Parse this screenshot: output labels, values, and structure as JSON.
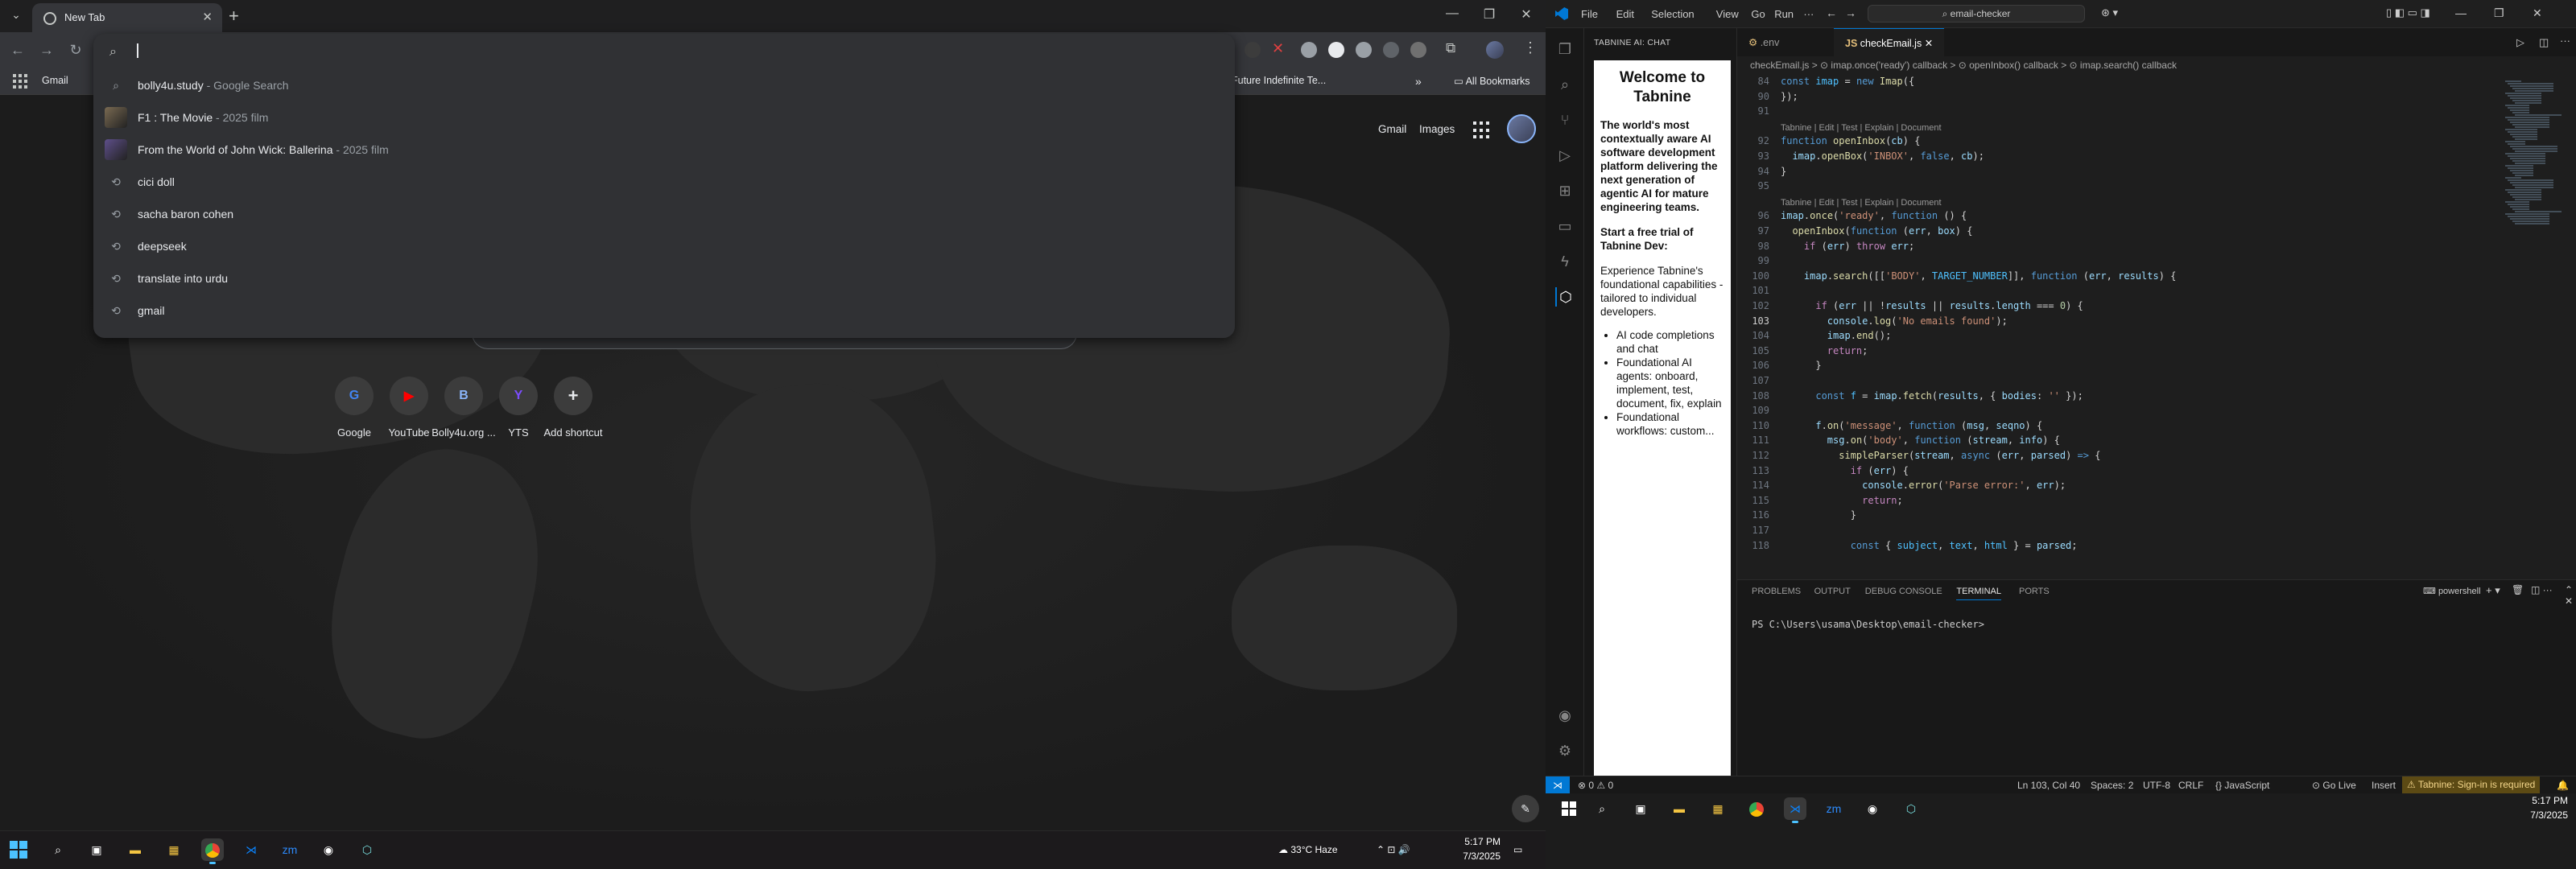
{
  "chrome": {
    "tab_title": "New Tab",
    "bookmarks": [
      {
        "label": "Gmail"
      },
      {
        "label": "Future Indefinite Te..."
      }
    ],
    "all_bookmarks_label": "All Bookmarks",
    "omnibox_value": "",
    "suggestions": [
      {
        "icon": "search-icon",
        "text": "bolly4u.study",
        "sub": "- Google Search"
      },
      {
        "icon": "thumbnail",
        "text": "F1 : The Movie",
        "sub": "- 2025 film",
        "thumb_color": "#7a6a52"
      },
      {
        "icon": "thumbnail",
        "text": "From the World of John Wick: Ballerina",
        "sub": "- 2025 film",
        "thumb_color": "#5e4f8a"
      },
      {
        "icon": "history-icon",
        "text": "cici doll",
        "sub": ""
      },
      {
        "icon": "history-icon",
        "text": "sacha baron cohen",
        "sub": ""
      },
      {
        "icon": "history-icon",
        "text": "deepseek",
        "sub": ""
      },
      {
        "icon": "history-icon",
        "text": "translate into urdu",
        "sub": ""
      },
      {
        "icon": "history-icon",
        "text": "gmail",
        "sub": ""
      }
    ],
    "ntp": {
      "gmail_label": "Gmail",
      "images_label": "Images",
      "shortcuts": [
        {
          "label": "Google",
          "glyph": "G",
          "color": "#4285f4"
        },
        {
          "label": "YouTube",
          "glyph": "▶",
          "color": "#ff0000"
        },
        {
          "label": "Bolly4u.org ...",
          "glyph": "B",
          "color": "#8ab4f8"
        },
        {
          "label": "YTS",
          "glyph": "Y",
          "color": "#7c4dff"
        },
        {
          "label": "Add shortcut",
          "glyph": "+",
          "color": "#e8eaed"
        }
      ]
    }
  },
  "vscode": {
    "menu": [
      "File",
      "Edit",
      "Selection",
      "View",
      "Go",
      "Run",
      "···"
    ],
    "command_center": "email-checker",
    "sidebar_title": "TABNINE AI: CHAT",
    "tabnine": {
      "welcome": "Welcome to Tabnine",
      "intro": "The world's most contextually aware AI software development platform delivering the next generation of agentic AI for mature engineering teams.",
      "trial": "Start a free trial of Tabnine Dev:",
      "desc": "Experience Tabnine's foundational capabilities - tailored to individual developers.",
      "features": [
        "AI code completions and chat",
        "Foundational AI agents: onboard, implement, test, document, fix, explain",
        "Foundational workflows: custom..."
      ]
    },
    "tabs": [
      {
        "label": ".env",
        "active": false
      },
      {
        "label": "checkEmail.js",
        "active": true
      }
    ],
    "breadcrumb": "checkEmail.js > ⊙ imap.once('ready') callback > ⊙ openInbox() callback > ⊙ imap.search() callback",
    "codelens": "Tabnine | Edit | Test | Explain | Document",
    "code": [
      {
        "n": "84",
        "html": "<span class='kb'>const</span> <span class='c'>imap</span> = <span class='kb'>new</span> <span class='f'>Imap</span>({"
      },
      {
        "n": "90",
        "html": "});"
      },
      {
        "n": "91",
        "html": ""
      },
      {
        "lens": true
      },
      {
        "n": "92",
        "html": "<span class='kb'>function</span> <span class='f'>openInbox</span>(<span class='v'>cb</span>) {"
      },
      {
        "n": "93",
        "html": "  <span class='v'>imap</span>.<span class='f'>openBox</span>(<span class='s'>'INBOX'</span>, <span class='kb'>false</span>, <span class='v'>cb</span>);"
      },
      {
        "n": "94",
        "html": "}"
      },
      {
        "n": "95",
        "html": ""
      },
      {
        "lens": true
      },
      {
        "n": "96",
        "html": "<span class='v'>imap</span>.<span class='f'>once</span>(<span class='s'>'ready'</span>, <span class='kb'>function</span> () {"
      },
      {
        "n": "97",
        "html": "  <span class='f'>openInbox</span>(<span class='kb'>function</span> (<span class='v'>err</span>, <span class='v'>box</span>) {"
      },
      {
        "n": "98",
        "html": "    <span class='k'>if</span> (<span class='v'>err</span>) <span class='k'>throw</span> <span class='v'>err</span>;"
      },
      {
        "n": "99",
        "html": ""
      },
      {
        "n": "100",
        "html": "    <span class='v'>imap</span>.<span class='f'>search</span>([[<span class='s'>'BODY'</span>, <span class='c'>TARGET_NUMBER</span>]], <span class='kb'>function</span> (<span class='v'>err</span>, <span class='v'>results</span>) {"
      },
      {
        "n": "101",
        "html": ""
      },
      {
        "n": "102",
        "html": "      <span class='k'>if</span> (<span class='v'>err</span> || !<span class='v'>results</span> || <span class='v'>results</span>.<span class='v'>length</span> === <span class='n'>0</span>) {"
      },
      {
        "n": "103",
        "html": "        <span class='v'>console</span>.<span class='f'>log</span>(<span class='s'>'No emails found'</span>);",
        "current": true
      },
      {
        "n": "104",
        "html": "        <span class='v'>imap</span>.<span class='f'>end</span>();"
      },
      {
        "n": "105",
        "html": "        <span class='k'>return</span>;"
      },
      {
        "n": "106",
        "html": "      }"
      },
      {
        "n": "107",
        "html": ""
      },
      {
        "n": "108",
        "html": "      <span class='kb'>const</span> <span class='c'>f</span> = <span class='v'>imap</span>.<span class='f'>fetch</span>(<span class='v'>results</span>, { <span class='v'>bodies</span>: <span class='s'>''</span> });"
      },
      {
        "n": "109",
        "html": ""
      },
      {
        "n": "110",
        "html": "      <span class='v'>f</span>.<span class='f'>on</span>(<span class='s'>'message'</span>, <span class='kb'>function</span> (<span class='v'>msg</span>, <span class='v'>seqno</span>) {"
      },
      {
        "n": "111",
        "html": "        <span class='v'>msg</span>.<span class='f'>on</span>(<span class='s'>'body'</span>, <span class='kb'>function</span> (<span class='v'>stream</span>, <span class='v'>info</span>) {"
      },
      {
        "n": "112",
        "html": "          <span class='f'>simpleParser</span>(<span class='v'>stream</span>, <span class='kb'>async</span> (<span class='v'>err</span>, <span class='v'>parsed</span>) <span class='kb'>=&gt;</span> {"
      },
      {
        "n": "113",
        "html": "            <span class='k'>if</span> (<span class='v'>err</span>) {"
      },
      {
        "n": "114",
        "html": "              <span class='v'>console</span>.<span class='f'>error</span>(<span class='s'>'Parse error:'</span>, <span class='v'>err</span>);"
      },
      {
        "n": "115",
        "html": "              <span class='k'>return</span>;"
      },
      {
        "n": "116",
        "html": "            }"
      },
      {
        "n": "117",
        "html": ""
      },
      {
        "n": "118",
        "html": "            <span class='kb'>const</span> { <span class='c'>subject</span>, <span class='c'>text</span>, <span class='c'>html</span> } = <span class='v'>parsed</span>;"
      }
    ],
    "panel_tabs": [
      "PROBLEMS",
      "OUTPUT",
      "DEBUG CONSOLE",
      "TERMINAL",
      "PORTS"
    ],
    "active_panel": "TERMINAL",
    "terminal_profile": "powershell",
    "terminal_prompt": "PS C:\\Users\\usama\\Desktop\\email-checker>",
    "status": {
      "problems": "⊗ 0 ⚠ 0",
      "position": "Ln 103, Col 40",
      "spaces": "Spaces: 2",
      "encoding": "UTF-8",
      "eol": "CRLF",
      "language": "{} JavaScript",
      "golive": "Go Live",
      "insert": "Insert",
      "tabnine": "Tabnine: Sign-in is required"
    }
  },
  "taskbar_left": {
    "weather": "33°C Haze",
    "time": "5:17 PM",
    "date": "7/3/2025"
  },
  "taskbar_right": {
    "time": "5:17 PM",
    "date": "7/3/2025"
  }
}
